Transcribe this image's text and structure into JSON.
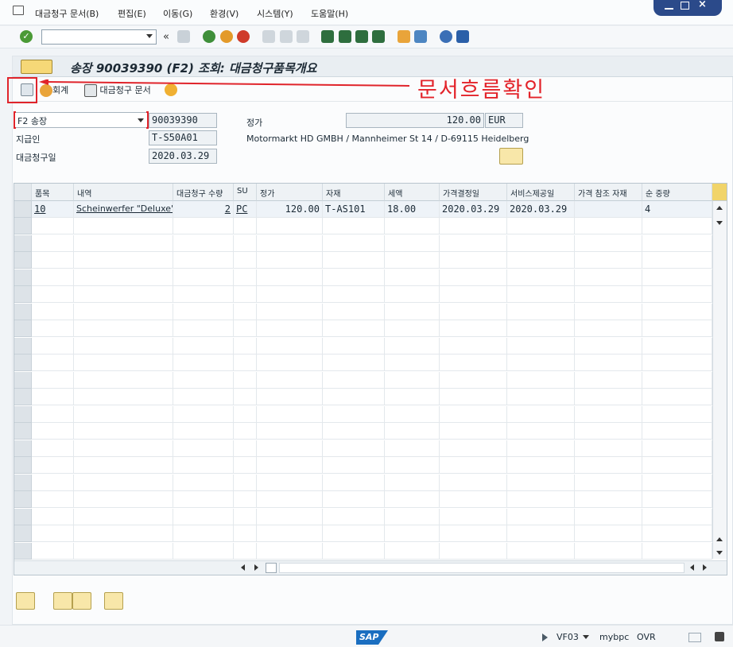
{
  "menu": {
    "items": [
      {
        "label": "대금청구 문서(B)"
      },
      {
        "label": "편집(E)"
      },
      {
        "label": "이동(G)"
      },
      {
        "label": "환경(V)"
      },
      {
        "label": "시스템(Y)"
      },
      {
        "label": "도움말(H)"
      }
    ]
  },
  "toolbar": {
    "command_value": "",
    "back_glyph": "«"
  },
  "screen": {
    "title": "송장 90039390  (F2) 조회: 대금청구품목개요"
  },
  "appbar": {
    "accounting_label": "회계",
    "billing_doc_label": "대금청구 문서"
  },
  "annotation": {
    "text": "문서흐름확인"
  },
  "header": {
    "billing_type": "F2 송장",
    "billing_number": "90039390",
    "payer_label": "지급인",
    "payer_value": "T-S50A01",
    "billing_date_label": "대금청구일",
    "billing_date_value": "2020.03.29",
    "net_value_label": "정가",
    "net_value": "120.00",
    "currency": "EUR",
    "payer_address": "Motormarkt HD GMBH / Mannheimer St 14 / D-69115 Heidelberg"
  },
  "table": {
    "columns": [
      "품목",
      "내역",
      "대금청구 수량",
      "SU",
      "정가",
      "자재",
      "세액",
      "가격결정일",
      "서비스제공일",
      "가격 참조 자재",
      "순 중량"
    ],
    "rows": [
      [
        "10",
        "Scheinwerfer \"Deluxe\"",
        "2",
        "PC",
        "120.00",
        "T-AS101",
        "18.00",
        "2020.03.29",
        "2020.03.29",
        "",
        "4"
      ]
    ]
  },
  "status": {
    "tcode": "VF03",
    "client": "mybpc",
    "mode": "OVR",
    "sap_logo": "SAP"
  },
  "colors": {
    "annotation_red": "#e3232a",
    "sap_blue": "#1a6ec0"
  }
}
